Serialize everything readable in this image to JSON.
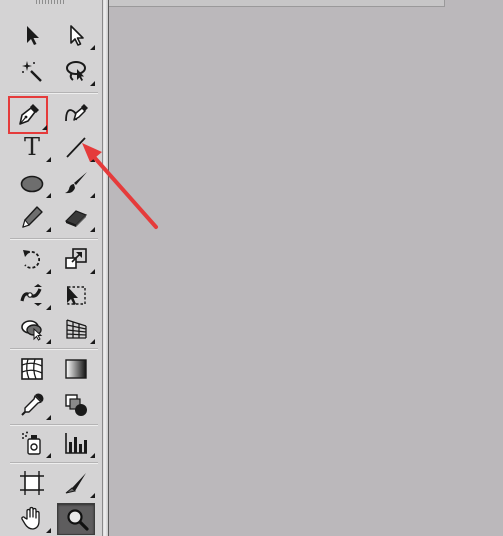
{
  "toolbar": {
    "type_tool_glyph": "T",
    "tools": [
      {
        "id": "selection",
        "icon": "selection-arrow-icon"
      },
      {
        "id": "direct-selection",
        "icon": "direct-selection-arrow-icon"
      },
      {
        "id": "magic-wand",
        "icon": "magic-wand-icon"
      },
      {
        "id": "lasso",
        "icon": "lasso-icon"
      },
      {
        "id": "pen",
        "icon": "pen-icon",
        "highlighted": true
      },
      {
        "id": "curvature",
        "icon": "curvature-pen-icon"
      },
      {
        "id": "type",
        "icon": "type-T-icon"
      },
      {
        "id": "line-segment",
        "icon": "line-segment-icon"
      },
      {
        "id": "ellipse",
        "icon": "ellipse-icon"
      },
      {
        "id": "paintbrush",
        "icon": "paintbrush-icon"
      },
      {
        "id": "pencil",
        "icon": "pencil-icon"
      },
      {
        "id": "eraser",
        "icon": "eraser-icon"
      },
      {
        "id": "rotate",
        "icon": "rotate-icon"
      },
      {
        "id": "scale",
        "icon": "scale-icon"
      },
      {
        "id": "width",
        "icon": "width-tool-icon"
      },
      {
        "id": "free-transform",
        "icon": "free-transform-icon"
      },
      {
        "id": "shape-builder",
        "icon": "shape-builder-icon"
      },
      {
        "id": "perspective-grid",
        "icon": "perspective-grid-icon"
      },
      {
        "id": "mesh",
        "icon": "mesh-icon"
      },
      {
        "id": "gradient",
        "icon": "gradient-icon"
      },
      {
        "id": "eyedropper",
        "icon": "eyedropper-icon"
      },
      {
        "id": "blend",
        "icon": "blend-icon"
      },
      {
        "id": "symbol-sprayer",
        "icon": "symbol-sprayer-icon"
      },
      {
        "id": "column-graph",
        "icon": "column-graph-icon"
      },
      {
        "id": "artboard",
        "icon": "artboard-icon"
      },
      {
        "id": "slice",
        "icon": "slice-icon"
      },
      {
        "id": "hand",
        "icon": "hand-icon"
      },
      {
        "id": "zoom",
        "icon": "zoom-magnifier-icon",
        "active": true
      }
    ]
  },
  "annotation": {
    "color": "#e53b3b",
    "target_tool": "pen"
  },
  "colors": {
    "toolbar_bg": "#d4d3d4",
    "canvas_bg": "#bbb8bb",
    "active_tool_bg": "#5e5d5e",
    "highlight": "#e53b3b"
  }
}
